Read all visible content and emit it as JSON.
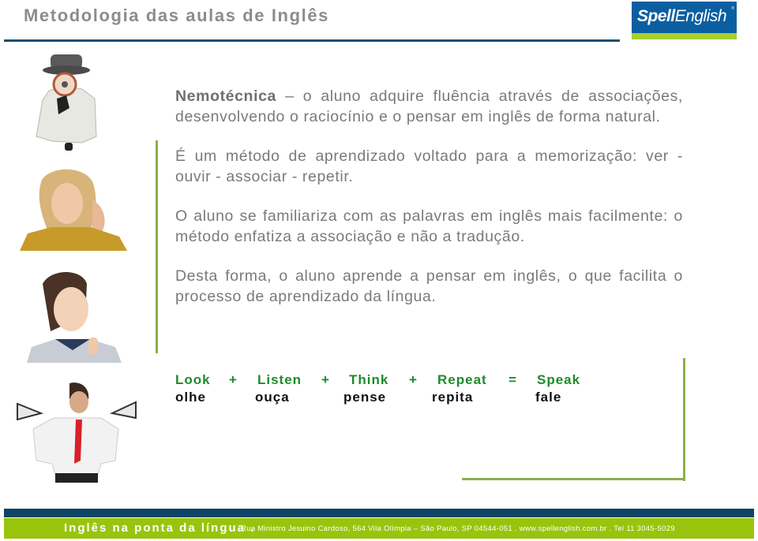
{
  "header": {
    "title": "Metodologia das aulas de Inglês",
    "logo": {
      "part1": "Spell",
      "part2": "English",
      "registered": "®"
    }
  },
  "colors": {
    "title_gray": "#8c8c8c",
    "header_rule": "#1f4e6e",
    "logo_blue": "#0b5fa0",
    "logo_lime": "#a9cf2f",
    "accent_line_green": "#8db04a",
    "formula_green": "#1f8a2a",
    "footer_blue": "#0f4466",
    "footer_green": "#99c40d"
  },
  "images": [
    {
      "name": "detective-with-magnifying-glass",
      "represents": "look"
    },
    {
      "name": "woman-listening",
      "represents": "listen"
    },
    {
      "name": "woman-thinking",
      "represents": "think"
    },
    {
      "name": "man-with-megaphones",
      "represents": "speak"
    }
  ],
  "content": {
    "paragraphs": [
      {
        "lead": "Nemotécnica",
        "text": " – o aluno adquire fluência através de associações, desenvolvendo o raciocínio e o pensar em inglês de forma natural."
      },
      {
        "lead": "",
        "text": "É um método de aprendizado voltado para a memorização: ver - ouvir - associar - repetir."
      },
      {
        "lead": "",
        "text": "O aluno se familiariza com as palavras em inglês mais facilmente: o método enfatiza a associação e não a tradução."
      },
      {
        "lead": "",
        "text": "Desta forma, o aluno aprende a pensar em inglês, o que facilita o processo de aprendizado da língua."
      }
    ]
  },
  "formula": {
    "english": [
      "Look",
      "+",
      "Listen",
      "+",
      "Think",
      "+",
      "Repeat",
      "=",
      "Speak"
    ],
    "portuguese": [
      "olhe",
      "ouça",
      "pense",
      "repita",
      "fale"
    ]
  },
  "footer": {
    "slogan": "Inglês na ponta da língua .",
    "address": "Rua Ministro Jesuino Cardoso, 564 Vila Olímpia – São Paulo, SP 04544-051  .  www.spellenglish.com.br  .  Tel 11 3045-5029"
  }
}
